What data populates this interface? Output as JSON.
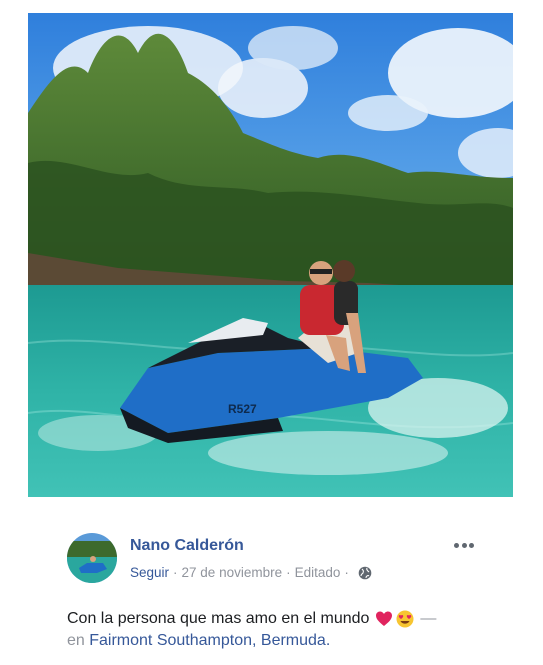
{
  "photo": {
    "icon": "jet-ski-couple-photo",
    "watercraft_label": "R527"
  },
  "post": {
    "author": "Nano Calderón",
    "follow_label": "Seguir",
    "separator": "·",
    "date": "27 de noviembre",
    "edited_label": "Editado",
    "privacy_icon": "globe-icon",
    "more_icon": "more-options-icon",
    "text_before": "Con la persona que mas amo en el mundo",
    "emojis": [
      "red-heart-emoji",
      "heart-eyes-emoji"
    ],
    "dash": "—",
    "location_prefix": "en",
    "location": "Fairmont Southampton, Bermuda."
  },
  "colors": {
    "link_blue": "#365899",
    "meta_gray": "#90949c",
    "text_dark": "#1c1e21",
    "water": "#2aa79e",
    "sky": "#3f8ee0"
  }
}
